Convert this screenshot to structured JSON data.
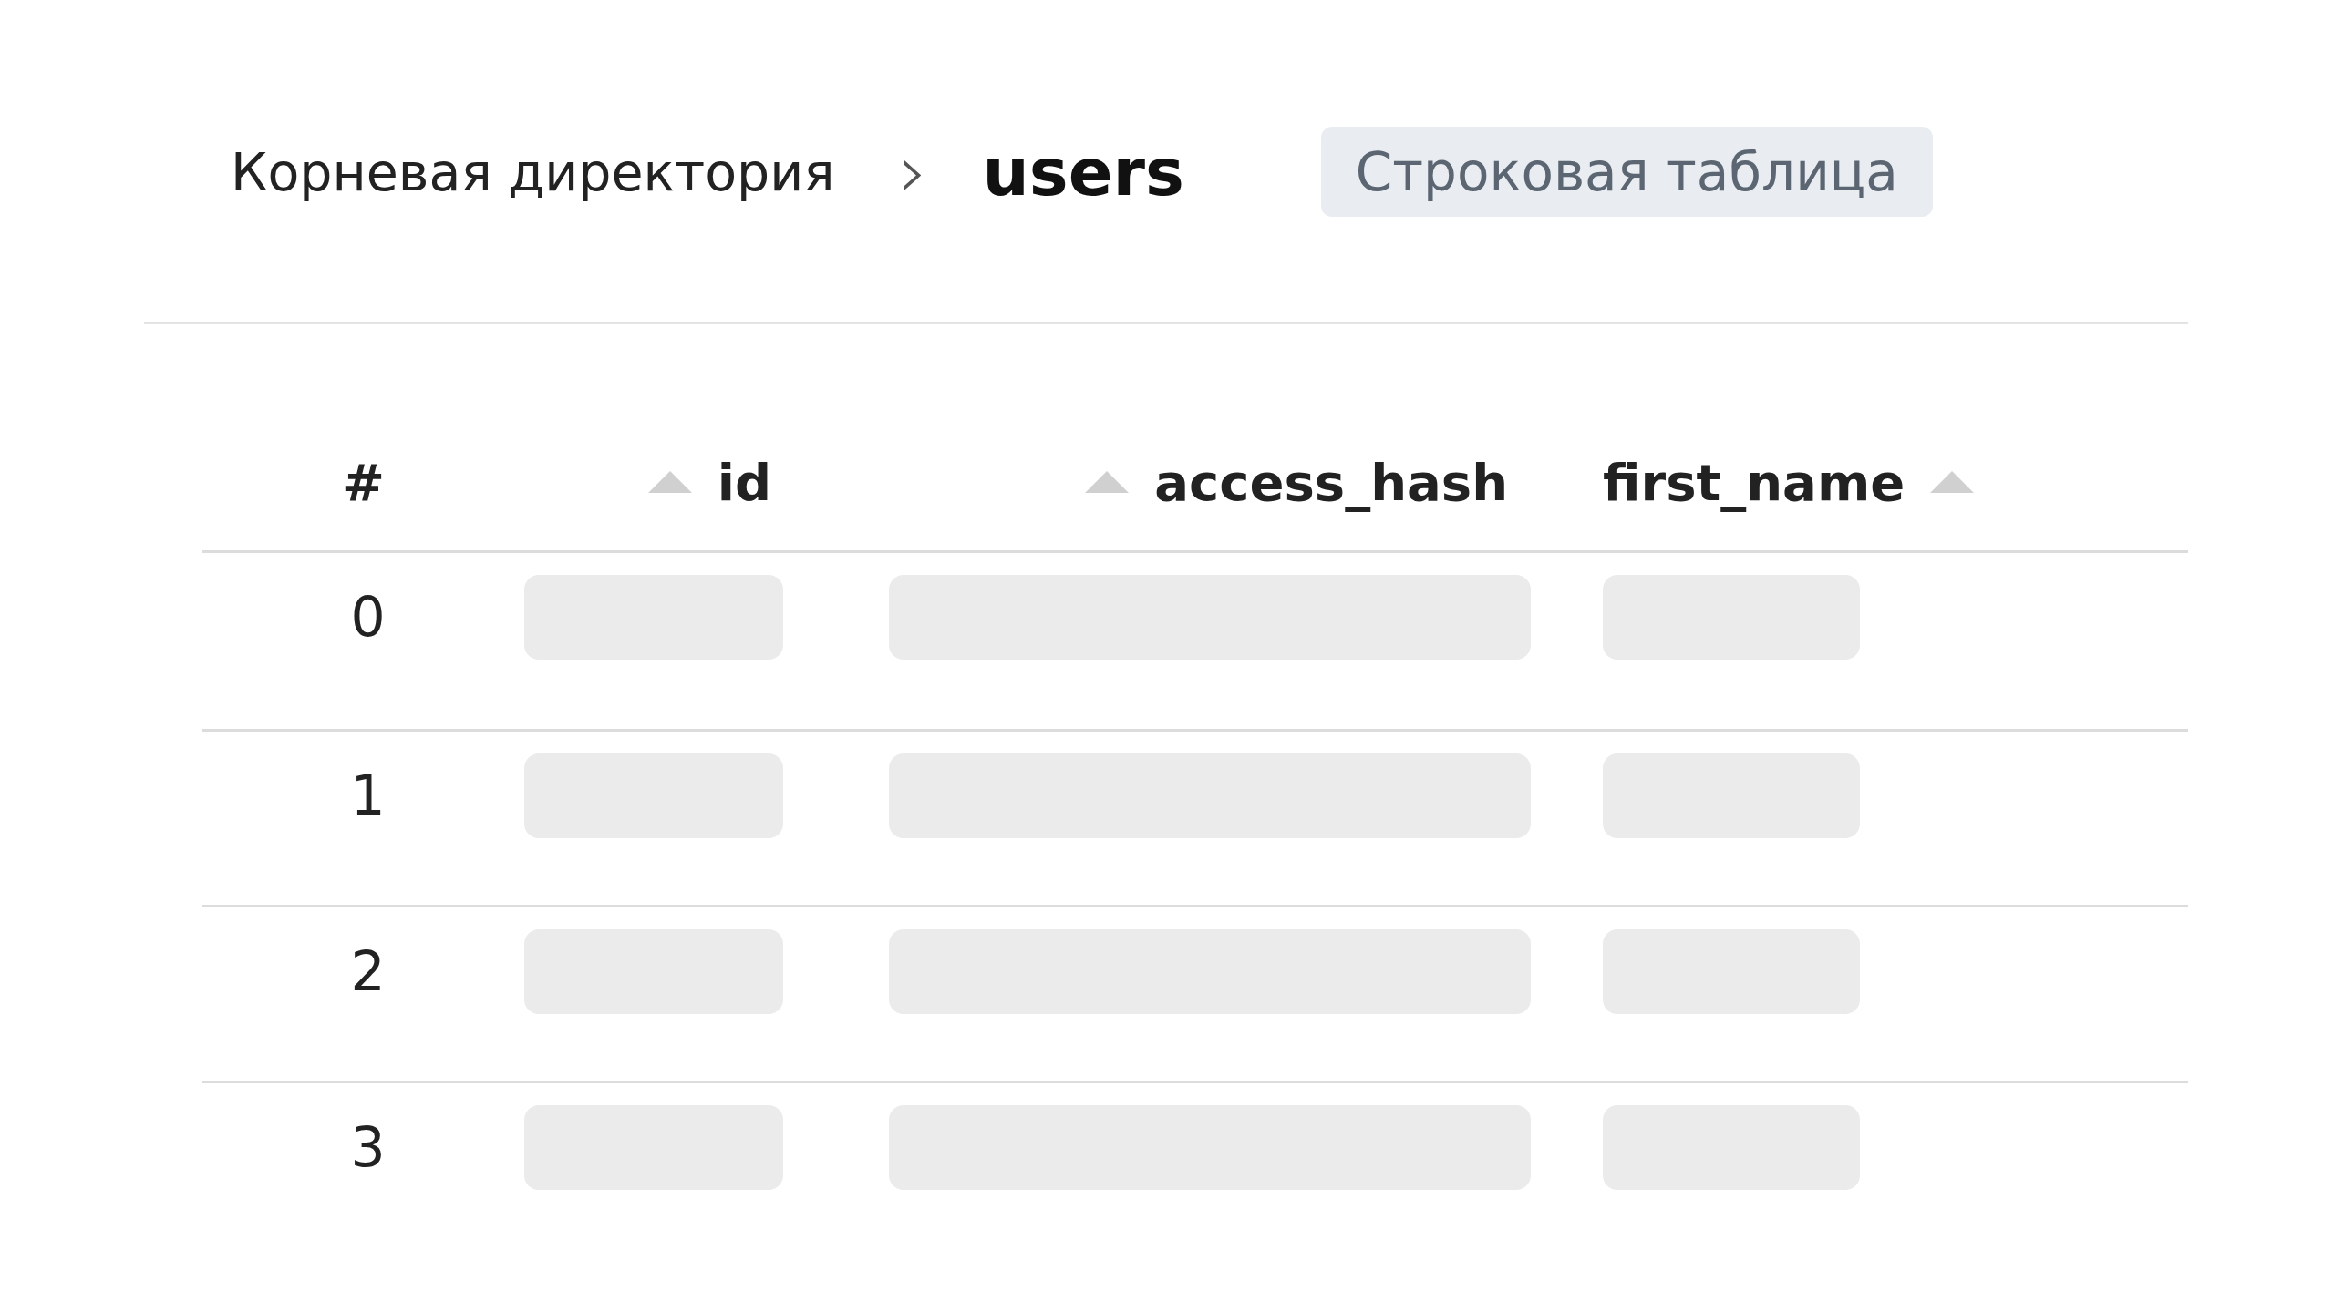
{
  "breadcrumb": {
    "root": "Корневая директория",
    "separator": "›",
    "current": "users",
    "badge": "Строковая таблица"
  },
  "table": {
    "columns": [
      {
        "label": "#",
        "kind": "plain"
      },
      {
        "label": "id",
        "kind": "leading"
      },
      {
        "label": "access_hash",
        "kind": "leading"
      },
      {
        "label": "first_name",
        "kind": "trailing"
      }
    ],
    "rows": [
      {
        "index": "0",
        "kind": "skeleton"
      },
      {
        "index": "1",
        "kind": "skeleton"
      },
      {
        "index": "2",
        "kind": "skeleton"
      },
      {
        "index": "3",
        "kind": "skeleton"
      }
    ]
  }
}
